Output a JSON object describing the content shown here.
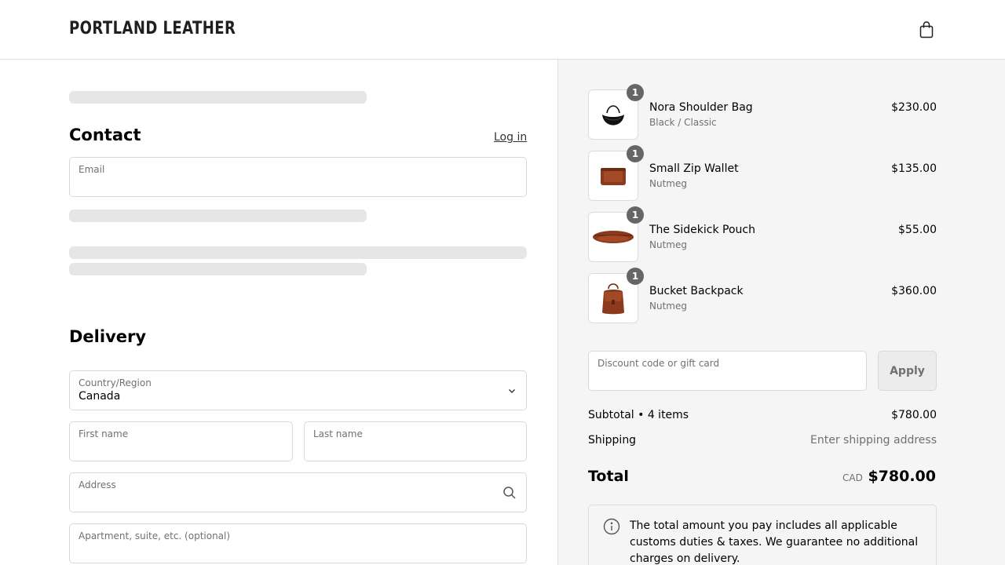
{
  "header": {
    "logo": "PORTLAND LEATHER",
    "cart_icon": "shopping-bag-icon"
  },
  "contact": {
    "title": "Contact",
    "login_link": "Log in",
    "email_label": "Email"
  },
  "delivery": {
    "title": "Delivery",
    "country_label": "Country/Region",
    "country_value": "Canada",
    "first_name_label": "First name",
    "last_name_label": "Last name",
    "address_label": "Address",
    "apartment_label": "Apartment, suite, etc. (optional)"
  },
  "cart": {
    "items": [
      {
        "name": "Nora Shoulder Bag",
        "variant": "Black / Classic",
        "price": "$230.00",
        "qty": "1"
      },
      {
        "name": "Small Zip Wallet",
        "variant": "Nutmeg",
        "price": "$135.00",
        "qty": "1"
      },
      {
        "name": "The Sidekick Pouch",
        "variant": "Nutmeg",
        "price": "$55.00",
        "qty": "1"
      },
      {
        "name": "Bucket Backpack",
        "variant": "Nutmeg",
        "price": "$360.00",
        "qty": "1"
      }
    ],
    "discount_label": "Discount code or gift card",
    "apply_label": "Apply",
    "subtotal_label": "Subtotal • 4 items",
    "subtotal_value": "$780.00",
    "shipping_label": "Shipping",
    "shipping_value": "Enter shipping address",
    "total_label": "Total",
    "total_currency": "CAD",
    "total_value": "$780.00",
    "notice": "The total amount you pay includes all applicable customs duties & taxes. We guarantee no additional charges on delivery."
  },
  "colors": {
    "accent_badge": "#666666",
    "summary_bg": "#f5f5f5",
    "skeleton": "#e6e6e6"
  }
}
